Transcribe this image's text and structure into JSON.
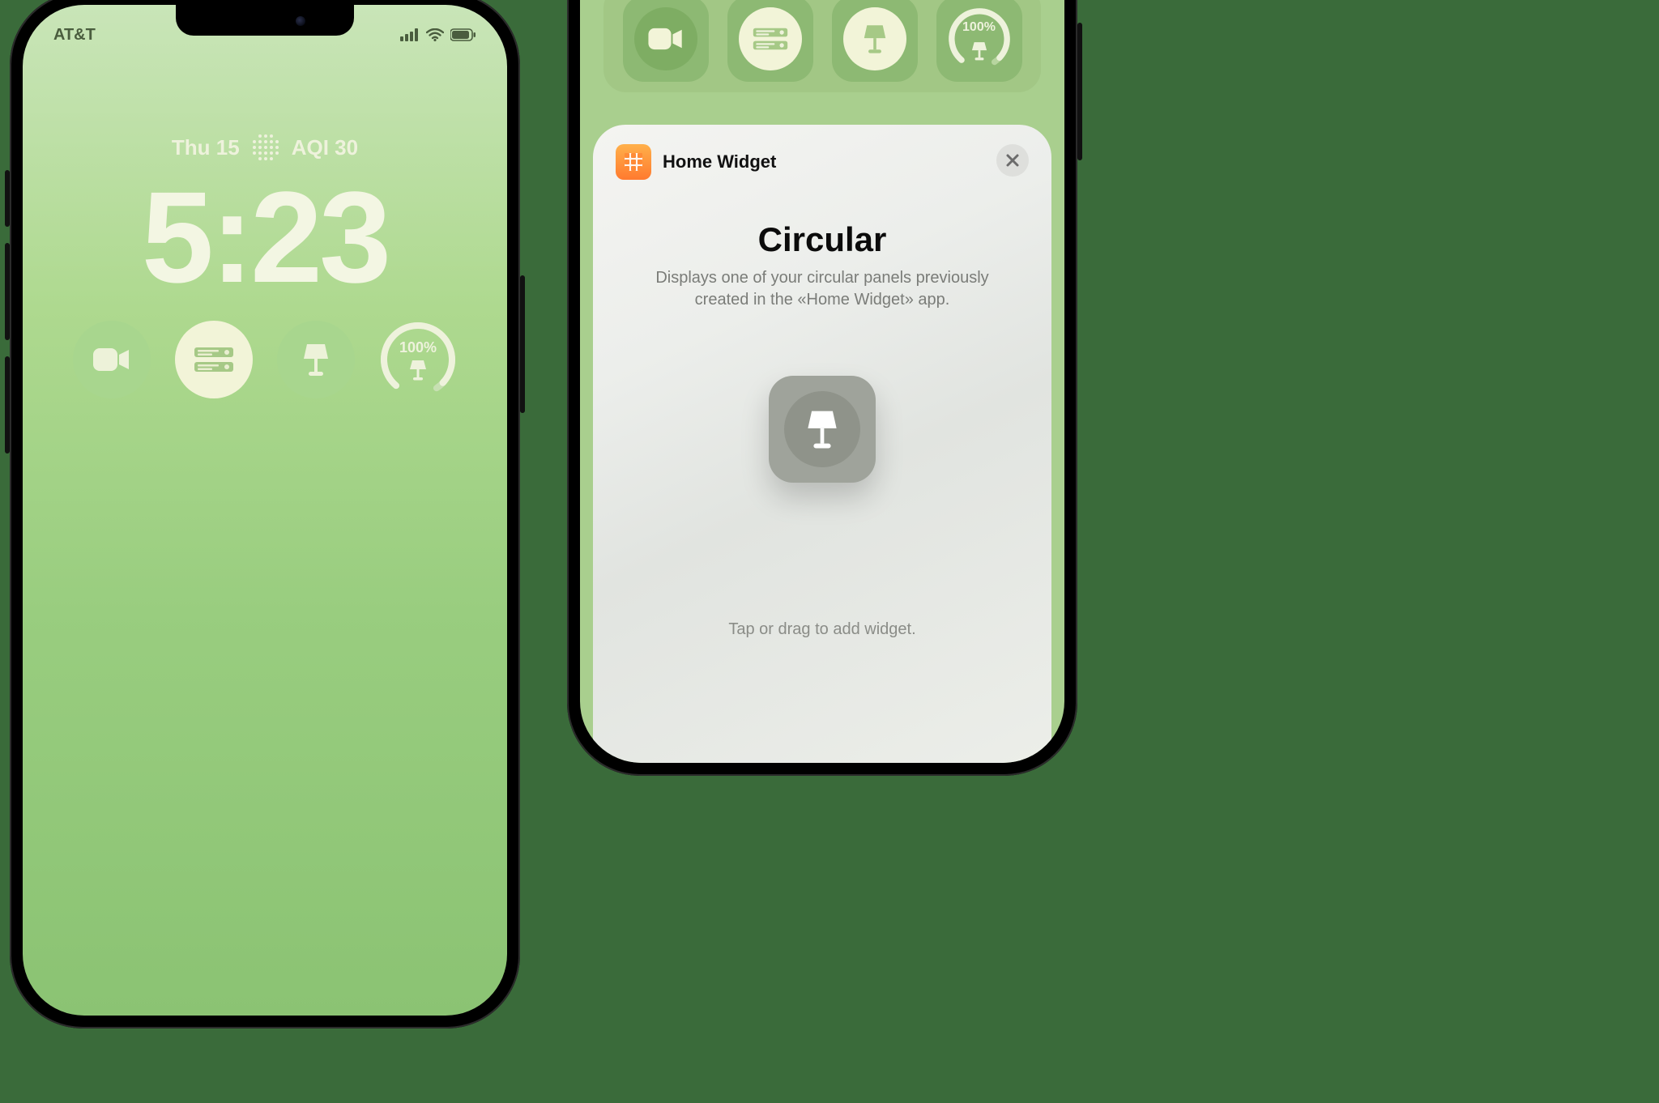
{
  "left_phone": {
    "carrier": "AT&T",
    "date_label": "Thu 15",
    "aqi_label": "AQI 30",
    "time": "5:23",
    "gauge_percent": "100%",
    "widgets": {
      "0": {
        "name": "camera-widget"
      },
      "1": {
        "name": "list-widget"
      },
      "2": {
        "name": "lamp-widget"
      },
      "3": {
        "name": "battery-lamp-gauge-widget"
      }
    }
  },
  "right_phone": {
    "edit_row": {
      "gauge_percent": "100%"
    },
    "sheet": {
      "app_name": "Home Widget",
      "title": "Circular",
      "description": "Displays one of your circular panels previously created in the «Home Widget» app.",
      "hint": "Tap or drag to add widget."
    }
  }
}
